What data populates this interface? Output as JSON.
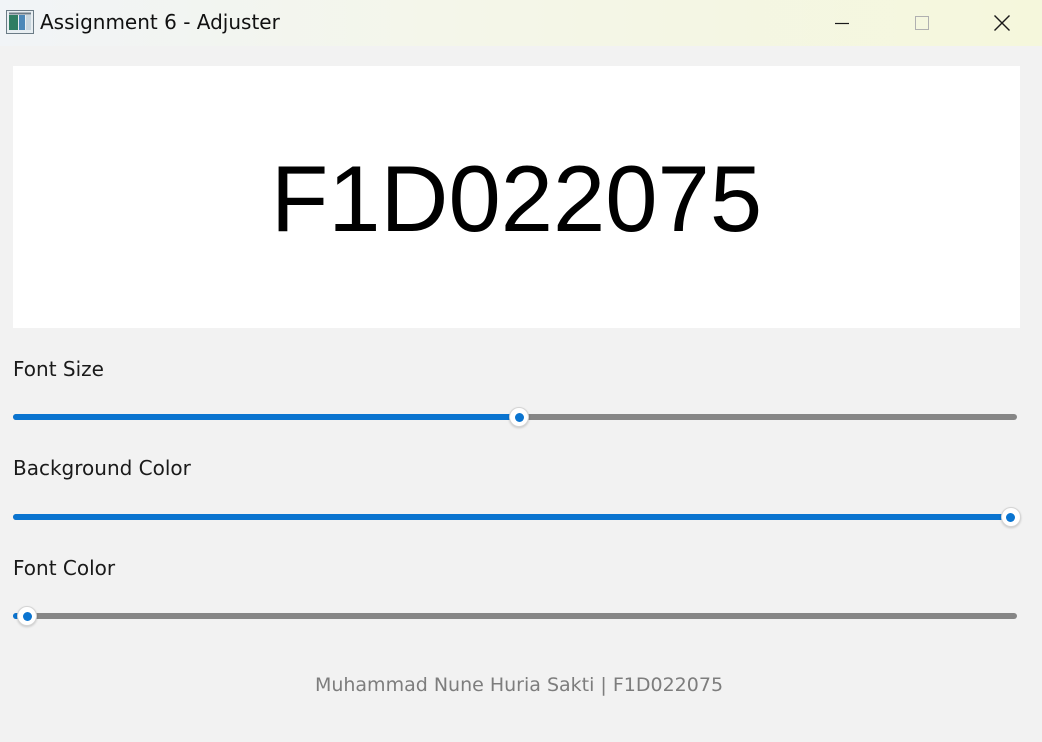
{
  "window": {
    "title": "Assignment 6 - Adjuster",
    "icons": [
      "app-icon",
      "minimize-icon",
      "maximize-icon",
      "close-icon"
    ]
  },
  "preview": {
    "text": "F1D022075",
    "background_color": "#ffffff",
    "font_color": "#000000"
  },
  "sliders": [
    {
      "label": "Font Size",
      "value_fraction": 0.504
    },
    {
      "label": "Background Color",
      "value_fraction": 0.994
    },
    {
      "label": "Font Color",
      "value_fraction": 0.014
    }
  ],
  "footer": {
    "text": "Muhammad Nune Huria Sakti | F1D022075"
  },
  "colors": {
    "accent": "#0a74d0",
    "track": "#868686",
    "window_bg": "#f2f2f2",
    "footer_text": "#7d7d7d"
  }
}
